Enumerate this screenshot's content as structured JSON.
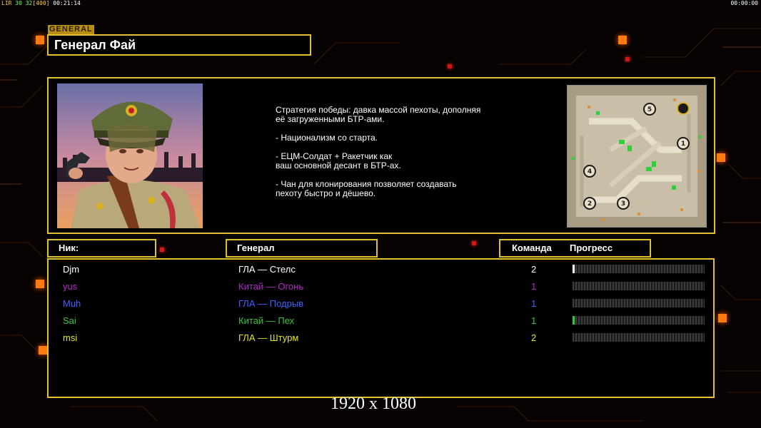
{
  "hud": {
    "left_prefix": "LIR",
    "left_values": "30 32",
    "left_bracket": "[400]",
    "left_time": "00:21:14",
    "right_time": "00:00:00"
  },
  "general_tag": "GENERAL",
  "title": "Генерал Фай",
  "strategy_text": "Стратегия победы: давка массой пехоты, дополняя\n её загруженными БТР-ами.\n\n- Национализм со старта.\n\n- ЕЦМ-Солдат + Ракетчик как\nваш основной десант в БТР-ах.\n\n- Чан для клонирования позволяет создавать\n пехоту быстро и дёшево.",
  "minimap": {
    "spots": [
      "5",
      "1",
      "4",
      "2",
      "3"
    ]
  },
  "headers": {
    "nick": "Ник:",
    "general": "Генерал",
    "team": "Команда",
    "progress": "Прогресс"
  },
  "players": [
    {
      "nick": "Djm",
      "general": "ГЛА — Стелс",
      "team": "2",
      "color": "#ffffff",
      "progress": 0.01
    },
    {
      "nick": "yus",
      "general": "Китай — Огонь",
      "team": "1",
      "color": "#b327c9",
      "progress": 0.0
    },
    {
      "nick": "Muh",
      "general": "ГЛА — Подрыв",
      "team": "1",
      "color": "#3e62ff",
      "progress": 0.0
    },
    {
      "nick": "Sai",
      "general": "Китай — Пех",
      "team": "1",
      "color": "#36c936",
      "progress": 0.01
    },
    {
      "nick": "msi",
      "general": "ГЛА — Штурм",
      "team": "2",
      "color": "#e4e42a",
      "progress": 0.0
    }
  ],
  "resolution_watermark": "1920 x 1080"
}
